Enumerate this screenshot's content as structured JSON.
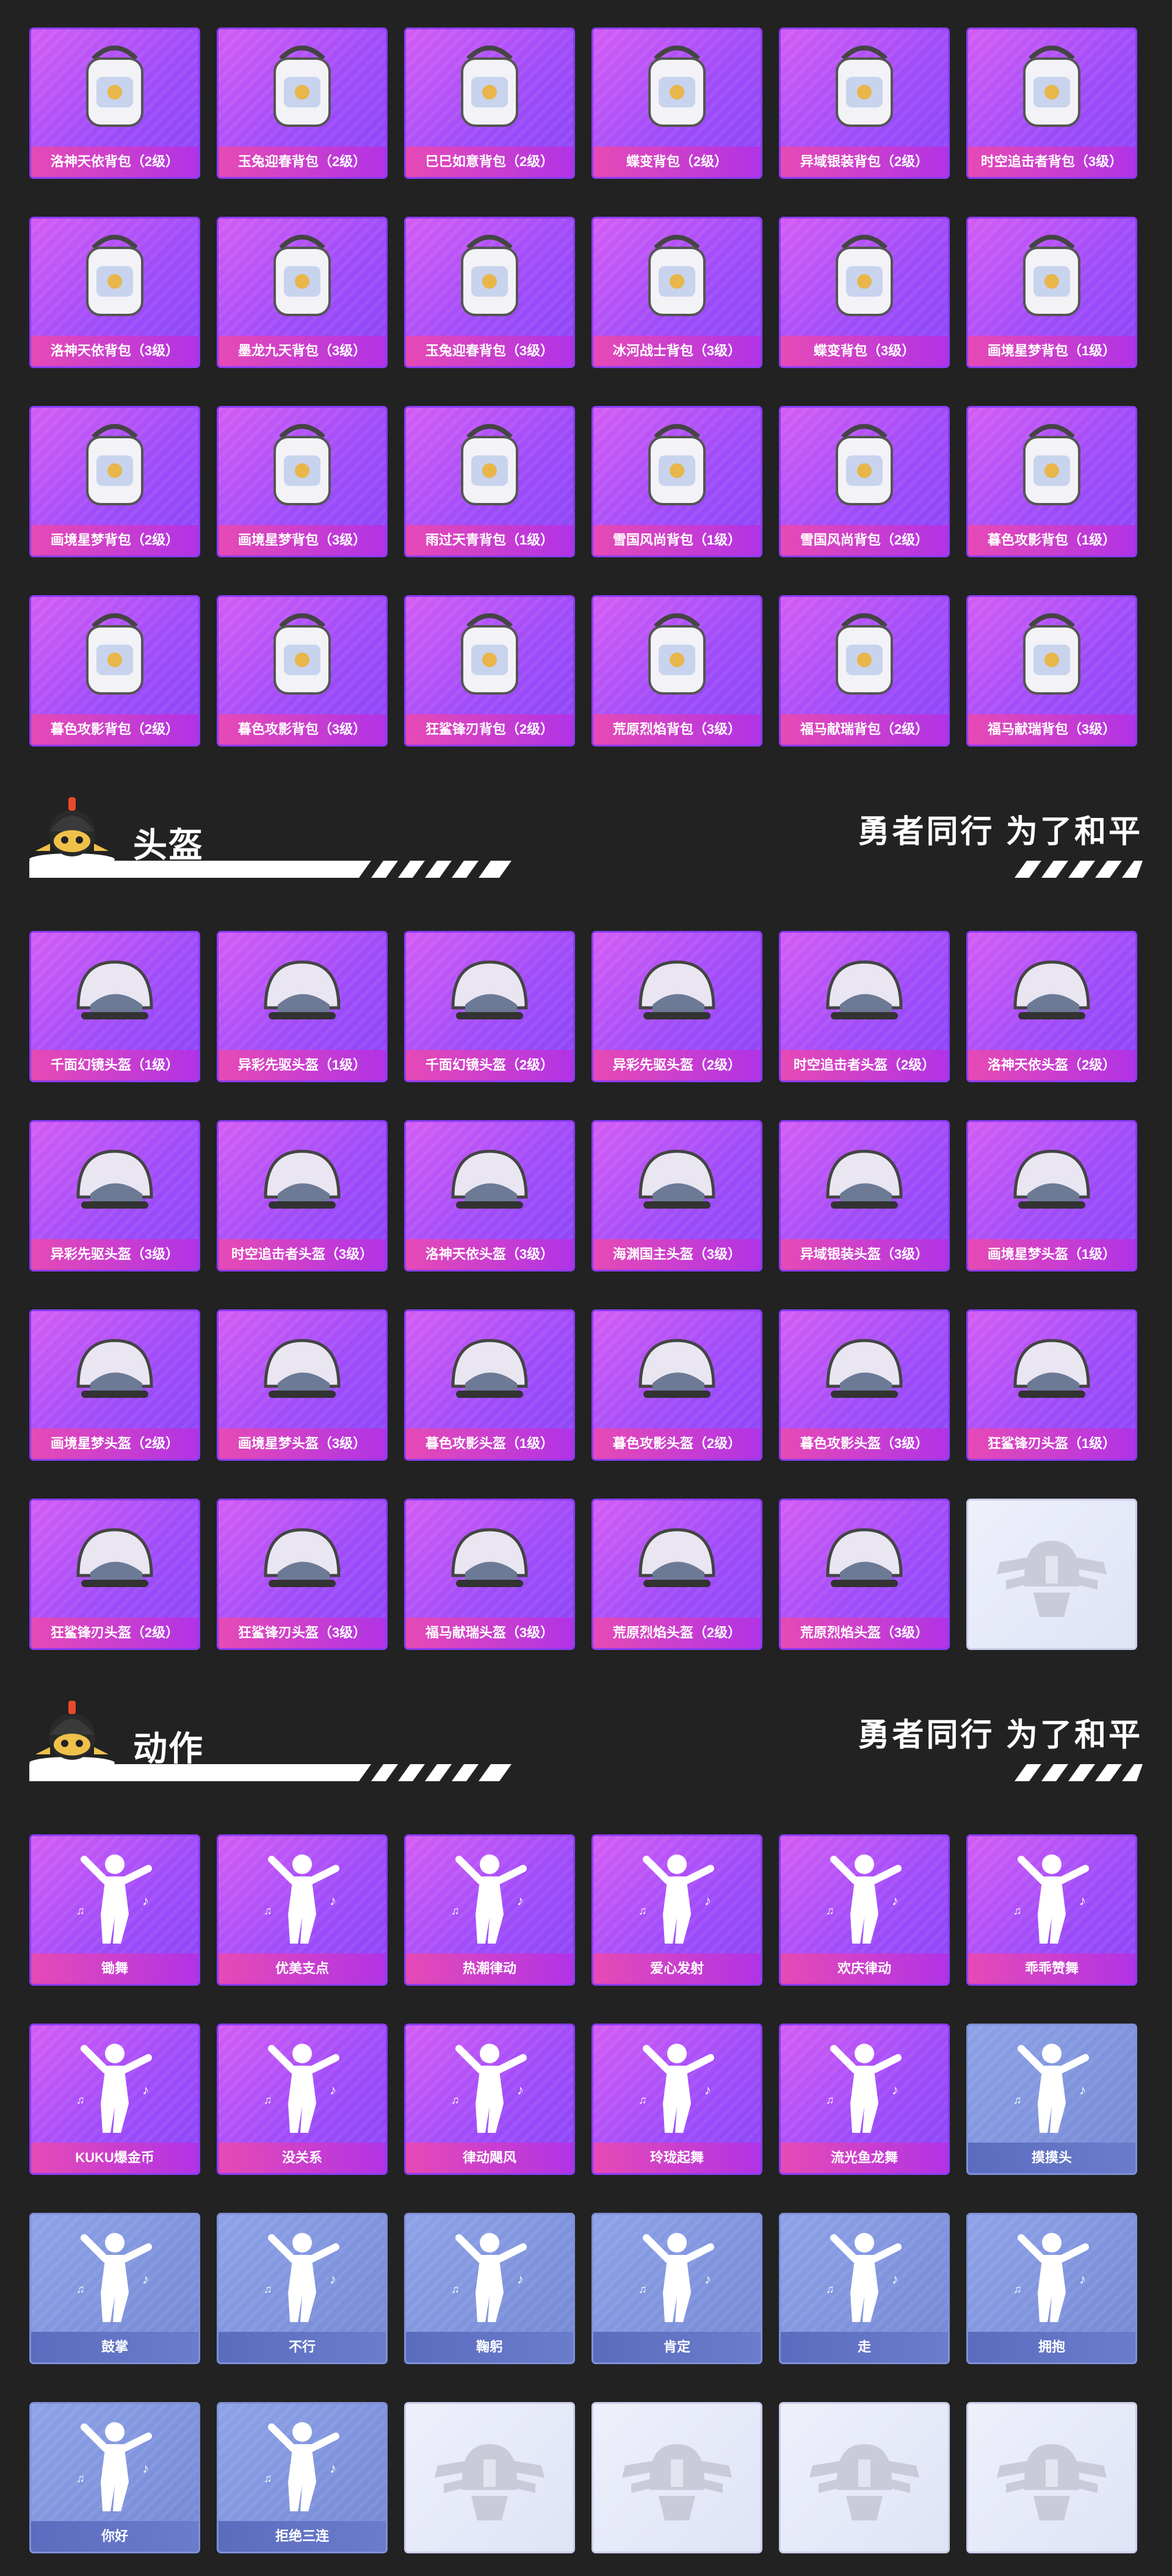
{
  "backpacks": [
    "洛神天依背包（2级）",
    "玉兔迎春背包（2级）",
    "巳巳如意背包（2级）",
    "蝶变背包（2级）",
    "异域银装背包（2级）",
    "时空追击者背包（3级）",
    "洛神天依背包（3级）",
    "墨龙九天背包（3级）",
    "玉兔迎春背包（3级）",
    "冰河战士背包（3级）",
    "蝶变背包（3级）",
    "画境星梦背包（1级）",
    "画境星梦背包（2级）",
    "画境星梦背包（3级）",
    "雨过天青背包（1级）",
    "雪国风尚背包（1级）",
    "雪国风尚背包（2级）",
    "暮色攻影背包（1级）",
    "暮色攻影背包（2级）",
    "暮色攻影背包（3级）",
    "狂鲨锋刃背包（2级）",
    "荒原烈焰背包（3级）",
    "福马献瑞背包（2级）",
    "福马献瑞背包（3级）"
  ],
  "helmet_section": {
    "title": "头盔",
    "slogan": "勇者同行 为了和平"
  },
  "helmets": [
    "千面幻镜头盔（1级）",
    "异彩先驱头盔（1级）",
    "千面幻镜头盔（2级）",
    "异彩先驱头盔（2级）",
    "时空追击者头盔（2级）",
    "洛神天依头盔（2级）",
    "异彩先驱头盔（3级）",
    "时空追击者头盔（3级）",
    "洛神天依头盔（3级）",
    "海渊国主头盔（3级）",
    "异域银装头盔（3级）",
    "画境星梦头盔（1级）",
    "画境星梦头盔（2级）",
    "画境星梦头盔（3级）",
    "暮色攻影头盔（1级）",
    "暮色攻影头盔（2级）",
    "暮色攻影头盔（3级）",
    "狂鲨锋刃头盔（1级）",
    "狂鲨锋刃头盔（2级）",
    "狂鲨锋刃头盔（3级）",
    "福马献瑞头盔（3级）",
    "荒原烈焰头盔（2级）",
    "荒原烈焰头盔（3级）",
    ""
  ],
  "action_section": {
    "title": "动作",
    "slogan": "勇者同行 为了和平"
  },
  "actions": [
    "锄舞",
    "优美支点",
    "热潮律动",
    "爱心发射",
    "欢庆律动",
    "乖乖赞舞",
    "KUKU爆金币",
    "没关系",
    "律动飓风",
    "玲珑起舞",
    "流光鱼龙舞",
    "摸摸头",
    "鼓掌",
    "不行",
    "鞠躬",
    "肯定",
    "走",
    "拥抱",
    "你好",
    "拒绝三连",
    "",
    "",
    "",
    ""
  ],
  "colors": {
    "page_bg": "#222222",
    "card_purple": "#a04cfa",
    "label_pink": "#e64ab5",
    "card_blue": "#7488d4",
    "empty_card": "#e6e9f8"
  },
  "icons": {
    "mascot": "helmet-mascot-icon",
    "placeholder": "pubg-emblem-icon"
  }
}
